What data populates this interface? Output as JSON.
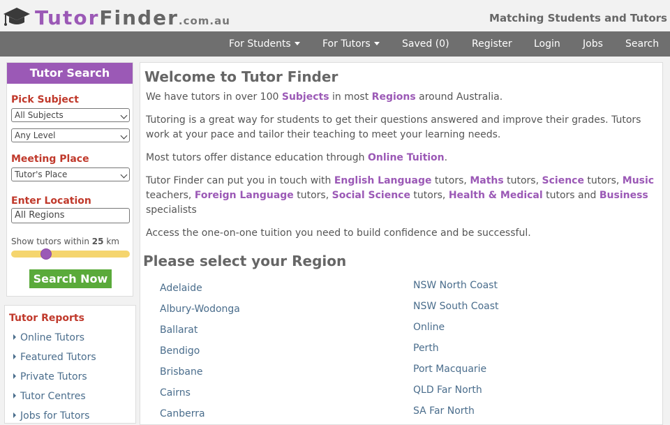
{
  "header": {
    "logo_tutor": "Tutor",
    "logo_finder": "Finder",
    "logo_domain": ".com.au",
    "tagline": "Matching Students and Tutors"
  },
  "nav": {
    "for_students": "For Students",
    "for_tutors": "For Tutors",
    "saved": "Saved (0)",
    "register": "Register",
    "login": "Login",
    "jobs": "Jobs",
    "search": "Search"
  },
  "search": {
    "title": "Tutor Search",
    "pick_subject": "Pick Subject",
    "subject_value": "All Subjects",
    "level_value": "Any Level",
    "meeting_place": "Meeting Place",
    "meeting_value": "Tutor's Place",
    "enter_location": "Enter Location",
    "location_value": "All Regions",
    "within_prefix": "Show tutors within",
    "within_value": "25",
    "within_unit": "km",
    "distance_fraction": 0.27,
    "button": "Search Now"
  },
  "reports": {
    "title": "Tutor Reports",
    "items": [
      "Online Tutors",
      "Featured Tutors",
      "Private Tutors",
      "Tutor Centres",
      "Jobs for Tutors"
    ]
  },
  "main": {
    "title": "Welcome to Tutor Finder",
    "p1": {
      "a": "We have tutors in over 100 ",
      "b": "Subjects",
      "c": " in most ",
      "d": "Regions",
      "e": " around Australia."
    },
    "p2": "Tutoring is a great way for students to get their questions answered and improve their grades. Tutors work at your pace and tailor their teaching to meet your learning needs.",
    "p3": {
      "a": "Most tutors offer distance education through ",
      "b": "Online Tuition",
      "c": "."
    },
    "p4": {
      "a": "Tutor Finder can put you in touch with ",
      "english": "English Language",
      "t1": " tutors, ",
      "maths": "Maths",
      "t2": " tutors, ",
      "science": "Science",
      "t3": " tutors, ",
      "music": "Music",
      "t4": " teachers, ",
      "foreign": "Foreign Language",
      "t5": " tutors, ",
      "social": "Social Science",
      "t6": " tutors, ",
      "health": "Health & Medical",
      "t7": " tutors and ",
      "business": "Business",
      "t8": " specialists"
    },
    "p5": "Access the one-on-one tuition you need to build confidence and be successful.",
    "region_title": "Please select your Region",
    "regions_left": [
      "Adelaide",
      "Albury-Wodonga",
      "Ballarat",
      "Bendigo",
      "Brisbane",
      "Cairns",
      "Canberra"
    ],
    "regions_right": [
      "NSW North Coast",
      "NSW South Coast",
      "Online",
      "Perth",
      "Port Macquarie",
      "QLD Far North",
      "SA Far North"
    ]
  },
  "colors": {
    "accent": "#9b59b6",
    "label_red": "#c0392b",
    "nav_bg": "#6f6f6f",
    "button_green": "#5aaa3a",
    "link_blue": "#4a6d8c",
    "slider_track": "#f5d56e"
  },
  "icons": {
    "logo": "graduation-cap-icon",
    "dropdown": "caret-down-icon",
    "list_bullet": "triangle-right-icon"
  }
}
